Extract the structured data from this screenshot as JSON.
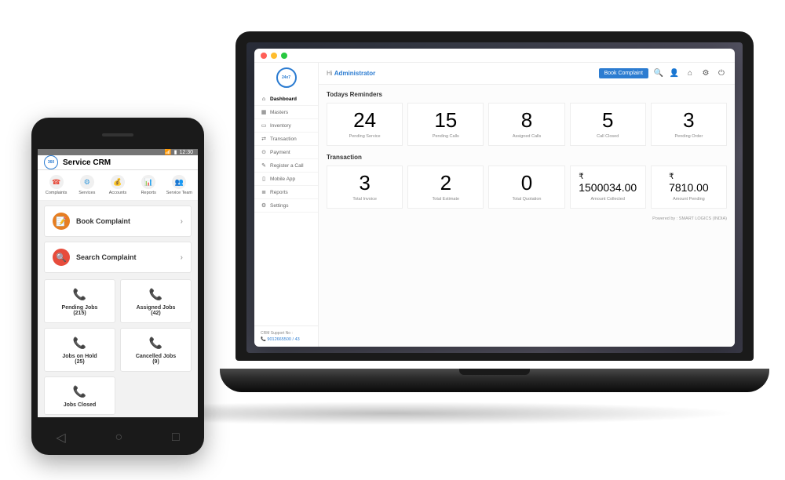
{
  "desktop": {
    "greeting_prefix": "Hi ",
    "greeting_user": "Administrator",
    "book_complaint_btn": "Book Complaint",
    "logo_text": "24x7",
    "sidebar": [
      {
        "icon": "⌂",
        "label": "Dashboard",
        "active": true
      },
      {
        "icon": "▦",
        "label": "Masters"
      },
      {
        "icon": "▭",
        "label": "Inventory"
      },
      {
        "icon": "⇄",
        "label": "Transaction"
      },
      {
        "icon": "⊙",
        "label": "Payment"
      },
      {
        "icon": "✎",
        "label": "Register a Call"
      },
      {
        "icon": "▯",
        "label": "Mobile App"
      },
      {
        "icon": "≣",
        "label": "Reports"
      },
      {
        "icon": "⚙",
        "label": "Settings"
      }
    ],
    "support_label": "CRM Support No :",
    "support_number": "9012665500 / 43",
    "section_reminders": "Todays Reminders",
    "reminders": [
      {
        "value": "24",
        "label": "Pending Service"
      },
      {
        "value": "15",
        "label": "Pending Calls"
      },
      {
        "value": "8",
        "label": "Assigned Calls"
      },
      {
        "value": "5",
        "label": "Call Closed"
      },
      {
        "value": "3",
        "label": "Pending Order"
      }
    ],
    "section_transaction": "Transaction",
    "transactions": [
      {
        "value": "3",
        "label": "Total Invoice",
        "currency": false
      },
      {
        "value": "2",
        "label": "Total Estimate",
        "currency": false
      },
      {
        "value": "0",
        "label": "Total Quotation",
        "currency": false
      },
      {
        "value": "1500034.00",
        "label": "Amount Collected",
        "currency": true
      },
      {
        "value": "7810.00",
        "label": "Amount Pending",
        "currency": true
      }
    ],
    "footer": "Powered by : SMART LOGICS (INDIA)"
  },
  "mobile": {
    "status_time": "12:30",
    "app_title": "Service CRM",
    "logo_text": "360",
    "top_icons": [
      {
        "label": "Complaints",
        "glyph": "☎",
        "color": "#e74c3c"
      },
      {
        "label": "Services",
        "glyph": "⚙",
        "color": "#3498db"
      },
      {
        "label": "Accounts",
        "glyph": "💰",
        "color": "#f39c12"
      },
      {
        "label": "Reports",
        "glyph": "📊",
        "color": "#16a085"
      },
      {
        "label": "Service Team",
        "glyph": "👥",
        "color": "#e67e22"
      }
    ],
    "actions": [
      {
        "label": "Book Complaint",
        "glyph": "📝",
        "bg": "#e67e22"
      },
      {
        "label": "Search Complaint",
        "glyph": "🔍",
        "bg": "#e74c3c"
      }
    ],
    "tiles": [
      {
        "label": "Pending Jobs",
        "count": "(215)",
        "glyph": "📞"
      },
      {
        "label": "Assigned Jobs",
        "count": "(42)",
        "glyph": "📞"
      },
      {
        "label": "Jobs on Hold",
        "count": "(25)",
        "glyph": "📞"
      },
      {
        "label": "Cancelled Jobs",
        "count": "(9)",
        "glyph": "📞"
      },
      {
        "label": "Jobs Closed",
        "count": "",
        "glyph": "📞"
      }
    ]
  }
}
